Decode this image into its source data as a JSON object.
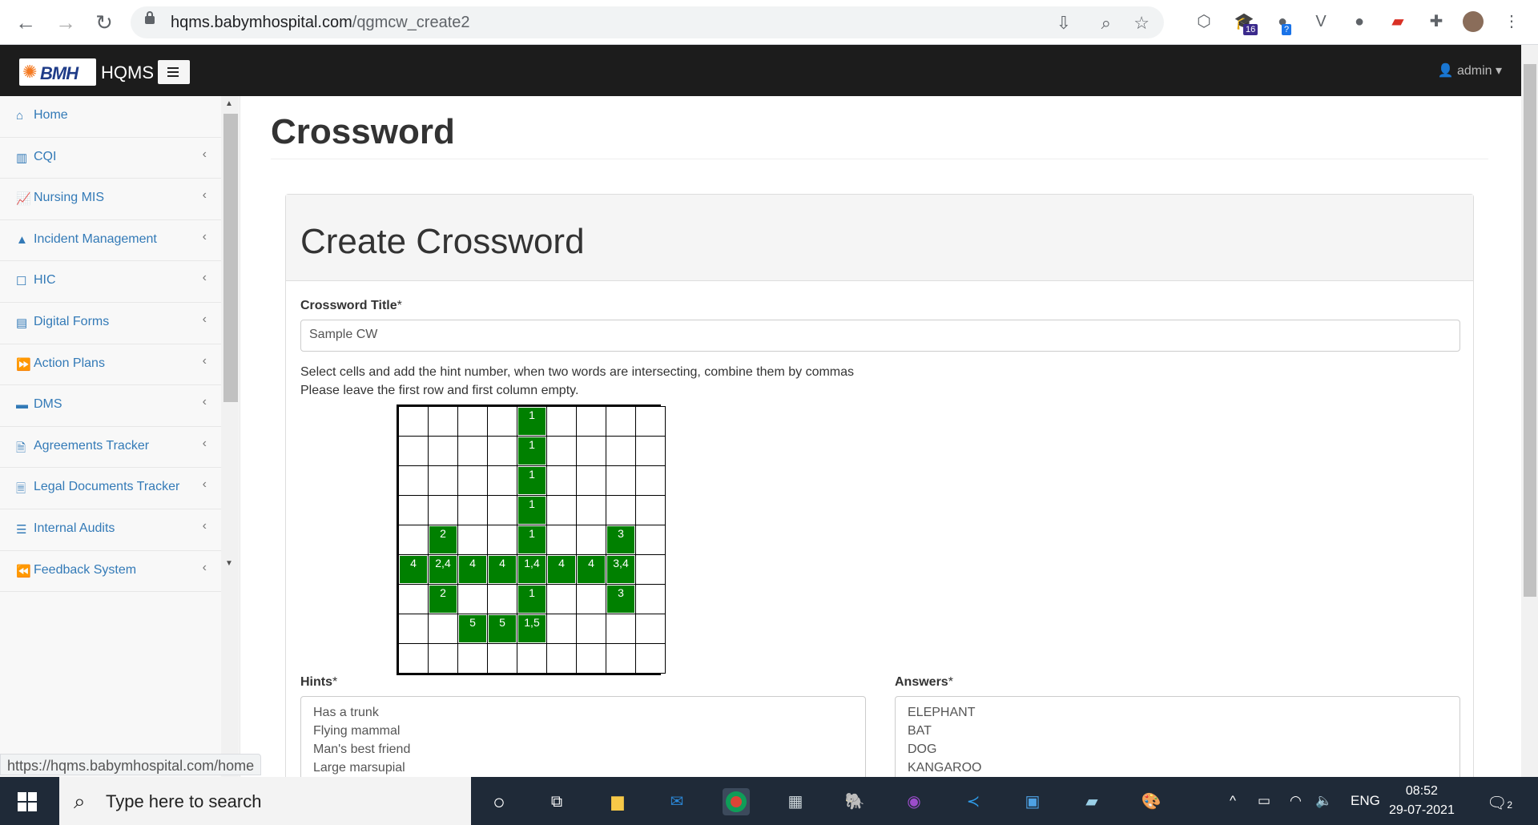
{
  "browser": {
    "url_host": "hqms.babymhospital.com",
    "url_path": "/qgmcw_create2",
    "ext_badge_1": "16",
    "ext_badge_2": "?"
  },
  "header": {
    "logo_text": "BMH",
    "brand": "HQMS",
    "user": "admin"
  },
  "sidebar": {
    "items": [
      {
        "label": "Home",
        "icon": "home-icon",
        "glyph": "⌂",
        "chevron": false
      },
      {
        "label": "CQI",
        "icon": "bar-chart-icon",
        "glyph": "▥",
        "chevron": true
      },
      {
        "label": "Nursing MIS",
        "icon": "line-chart-icon",
        "glyph": "📈",
        "chevron": true
      },
      {
        "label": "Incident Management",
        "icon": "warning-icon",
        "glyph": "▲",
        "chevron": true
      },
      {
        "label": "HIC",
        "icon": "square-icon",
        "glyph": "☐",
        "chevron": true
      },
      {
        "label": "Digital Forms",
        "icon": "calendar-icon",
        "glyph": "▤",
        "chevron": true
      },
      {
        "label": "Action Plans",
        "icon": "fast-forward-icon",
        "glyph": "⏩",
        "chevron": true
      },
      {
        "label": "DMS",
        "icon": "folder-icon",
        "glyph": "▬",
        "chevron": true
      },
      {
        "label": "Agreements Tracker",
        "icon": "document-icon",
        "glyph": "🗎",
        "chevron": true
      },
      {
        "label": "Legal Documents Tracker",
        "icon": "file-text-icon",
        "glyph": "🗏",
        "chevron": true
      },
      {
        "label": "Internal Audits",
        "icon": "list-icon",
        "glyph": "☰",
        "chevron": true
      },
      {
        "label": "Feedback System",
        "icon": "backward-icon",
        "glyph": "⏪",
        "chevron": true
      }
    ]
  },
  "page": {
    "title": "Crossword",
    "panel_title": "Create Crossword",
    "cw_title_label": "Crossword Title",
    "required_mark": "*",
    "cw_title_value": "Sample CW",
    "help_1": "Select cells and add the hint number, when two words are intersecting, combine them by commas",
    "help_2": "Please leave the first row and first column empty.",
    "hints_label": "Hints",
    "answers_label": "Answers",
    "hints": [
      "Has a trunk",
      "Flying mammal",
      "Man's best friend",
      "Large marsupial"
    ],
    "answers": [
      "ELEPHANT",
      "BAT",
      "DOG",
      "KANGAROO"
    ]
  },
  "grid": [
    [
      "",
      "",
      "",
      "",
      "1",
      "",
      "",
      "",
      ""
    ],
    [
      "",
      "",
      "",
      "",
      "1",
      "",
      "",
      "",
      ""
    ],
    [
      "",
      "",
      "",
      "",
      "1",
      "",
      "",
      "",
      ""
    ],
    [
      "",
      "",
      "",
      "",
      "1",
      "",
      "",
      "",
      ""
    ],
    [
      "",
      "2",
      "",
      "",
      "1",
      "",
      "",
      "3",
      ""
    ],
    [
      "4",
      "2,4",
      "4",
      "4",
      "1,4",
      "4",
      "4",
      "3,4",
      ""
    ],
    [
      "",
      "2",
      "",
      "",
      "1",
      "",
      "",
      "3",
      ""
    ],
    [
      "",
      "",
      "5",
      "5",
      "1,5",
      "",
      "",
      "",
      ""
    ],
    [
      "",
      "",
      "",
      "",
      "",
      "",
      "",
      "",
      ""
    ]
  ],
  "colors": {
    "filled": "#008000",
    "link": "#337ab7"
  },
  "status_url": "https://hqms.babymhospital.com/home",
  "taskbar": {
    "search_placeholder": "Type here to search",
    "lang": "ENG",
    "time": "08:52",
    "date": "29-07-2021",
    "notifications": "2"
  }
}
